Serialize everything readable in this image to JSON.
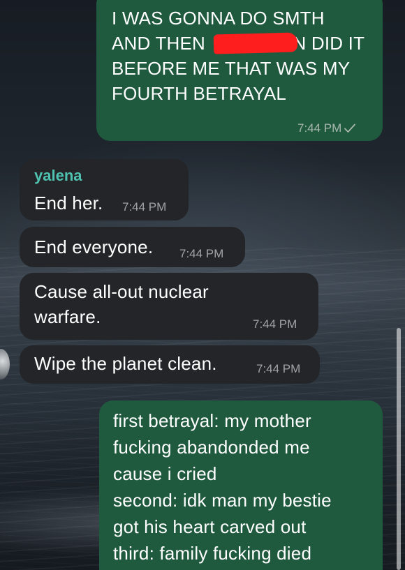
{
  "conversation": {
    "messages": [
      {
        "direction": "outgoing",
        "lines": [
          "I WAS GONNA DO SMTH",
          "AND THEN ",
          "BEFORE ME THAT WAS MY",
          "FOURTH BETRAYAL"
        ],
        "line2_tail": "N DID IT",
        "time": "7:44 PM",
        "status": "sent-check-icon"
      },
      {
        "direction": "incoming",
        "sender": "yalena",
        "text": "End her.",
        "time": "7:44 PM"
      },
      {
        "direction": "incoming",
        "text": "End everyone.",
        "time": "7:44 PM"
      },
      {
        "direction": "incoming",
        "lines": [
          "Cause all-out nuclear",
          "warfare."
        ],
        "time": "7:44 PM"
      },
      {
        "direction": "incoming",
        "text": "Wipe the planet clean.",
        "time": "7:44 PM"
      },
      {
        "direction": "outgoing",
        "lines": [
          "first betrayal: my mother",
          "fucking abandonded me",
          "cause i cried",
          "second: idk man my bestie",
          "got his heart carved out",
          "third: family fucking died"
        ]
      }
    ]
  },
  "colors": {
    "outgoing_bubble": "#1f5a3f",
    "incoming_bubble": "#232528",
    "sender_name": "#4fc3b0",
    "redaction": "#ff1e1e"
  },
  "icons": [
    "sent-check-icon",
    "avatar"
  ]
}
